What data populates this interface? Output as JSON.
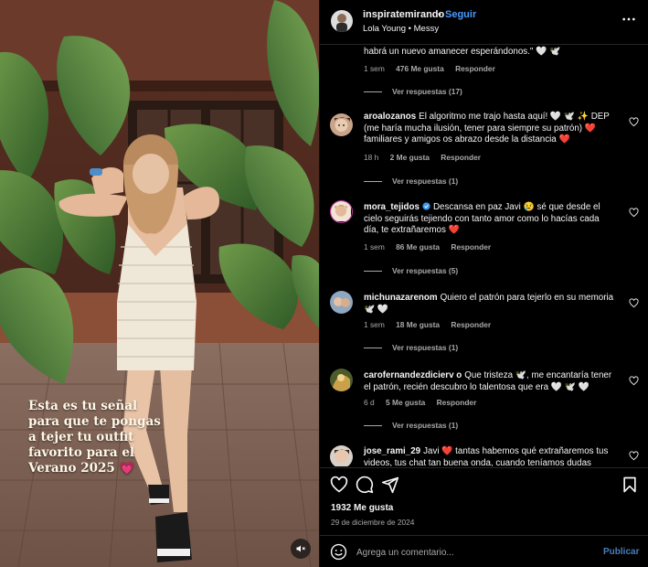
{
  "post": {
    "author": "inspiratemirando",
    "follow_label": "Seguir",
    "separator": "•",
    "audio": "Lola Young • Messy",
    "caption_overlay": "Esta es tu señal para que te pongas a tejer tu outfit favorito para el Verano 2025 💗",
    "likes": "1932 Me gusta",
    "date": "29 de diciembre de 2024"
  },
  "comments": {
    "truncated_top": {
      "text": "habrá un nuevo amanecer esperándonos.\" 🤍 🕊️",
      "time": "1 sem",
      "likes": "476 Me gusta",
      "reply_label": "Responder",
      "view_replies": "Ver respuestas (17)"
    },
    "items": [
      {
        "user": "aroalozanos",
        "text": "El algoritmo me trajo hasta aquí! 🤍 🕊️ ✨ DEP (me haría mucha ilusión, tener para siempre su patrón) ❤️ familiares y amigos os abrazo desde la distancia ❤️",
        "time": "18 h",
        "likes": "2 Me gusta",
        "reply_label": "Responder",
        "view_replies": "Ver respuestas (1)"
      },
      {
        "user": "mora_tejidos",
        "verified_icon": "verified-badge",
        "text": "Descansa en paz Javi 😢 sé que desde el cielo seguirás tejiendo con tanto amor como lo hacías cada día, te extrañaremos ❤️",
        "time": "1 sem",
        "likes": "86 Me gusta",
        "reply_label": "Responder",
        "view_replies": "Ver respuestas (5)"
      },
      {
        "user": "michunazarenom",
        "text": "Quiero el patrón para tejerlo en su memoria 🕊️ 🤍",
        "time": "1 sem",
        "likes": "18 Me gusta",
        "reply_label": "Responder",
        "view_replies": "Ver respuestas (1)"
      },
      {
        "user": "carofernandezdicierv o",
        "text": "Que tristeza 🕊️, me encantaría tener el patrón, recién descubro lo talentosa que era 🤍 🕊️ 🤍",
        "time": "6 d",
        "likes": "5 Me gusta",
        "reply_label": "Responder",
        "view_replies": "Ver respuestas (1)"
      },
      {
        "user": "jose_rami_29",
        "text": "Javi ❤️ tantas habemos qué extrañaremos tus videos, tus chat tan buena onda, cuando teníamos dudas",
        "time": "",
        "likes": "",
        "reply_label": "",
        "view_replies": ""
      }
    ]
  },
  "composer": {
    "placeholder": "Agrega un comentario...",
    "post_label": "Publicar"
  },
  "icons": {
    "more": "more-horizontal-icon",
    "like": "heart-icon",
    "comment": "comment-icon",
    "share": "send-icon",
    "save": "bookmark-icon",
    "emoji": "emoji-icon",
    "mute": "speaker-muted-icon"
  },
  "colors": {
    "background": "#000000",
    "follow_blue": "#4a9bff",
    "secondary_text": "#a8a8a8",
    "heart_red": "#ff3040",
    "divider": "#262626"
  }
}
